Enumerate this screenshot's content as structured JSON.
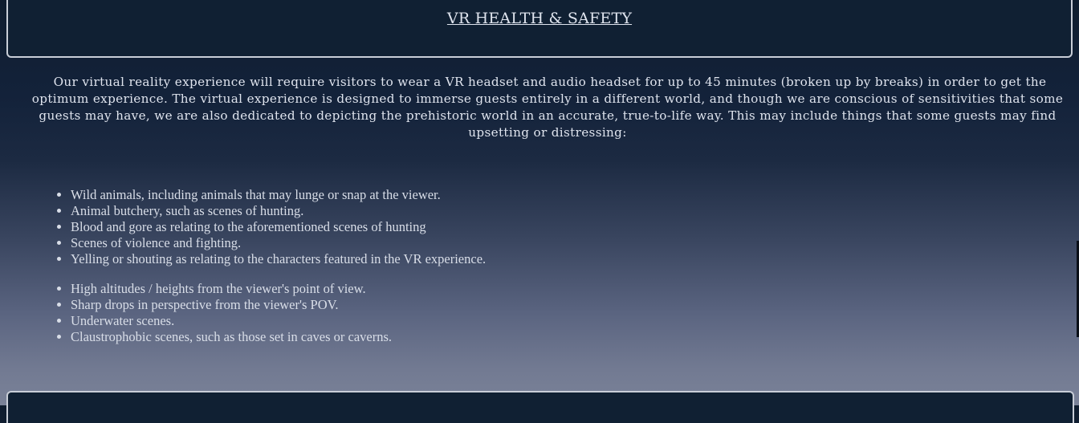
{
  "header": {
    "title": "VR HEALTH & SAFETY"
  },
  "intro": {
    "text": "Our virtual reality experience will require visitors to wear a VR headset and audio headset for up to 45 minutes (broken up by breaks) in order to get the optimum experience. The virtual experience is designed to immerse guests entirely in a different world, and though we are conscious of sensitivities that some guests may have, we are also dedicated to depicting the prehistoric world in an accurate, true-to-life way. This may include things that some guests may find upsetting or distressing:"
  },
  "content_warnings": [
    "Wild animals, including animals that may lunge or snap at the viewer.",
    "Animal butchery, such as scenes of hunting.",
    "Blood and gore as relating to the aforementioned scenes of hunting",
    "Scenes of violence and fighting.",
    "Yelling or shouting as relating to the characters featured in the VR experience."
  ],
  "physical_warnings": [
    "High altitudes / heights from the viewer's point of view.",
    "Sharp drops in perspective from the viewer's POV.",
    "Underwater scenes.",
    "Claustrophobic scenes, such as those set in caves or caverns."
  ],
  "colors": {
    "panel_background": "#102033",
    "panel_border": "#c9ced8",
    "text": "#dfe4ee",
    "gradient_top": "#0f1d2f",
    "gradient_bottom": "#7a8298"
  }
}
